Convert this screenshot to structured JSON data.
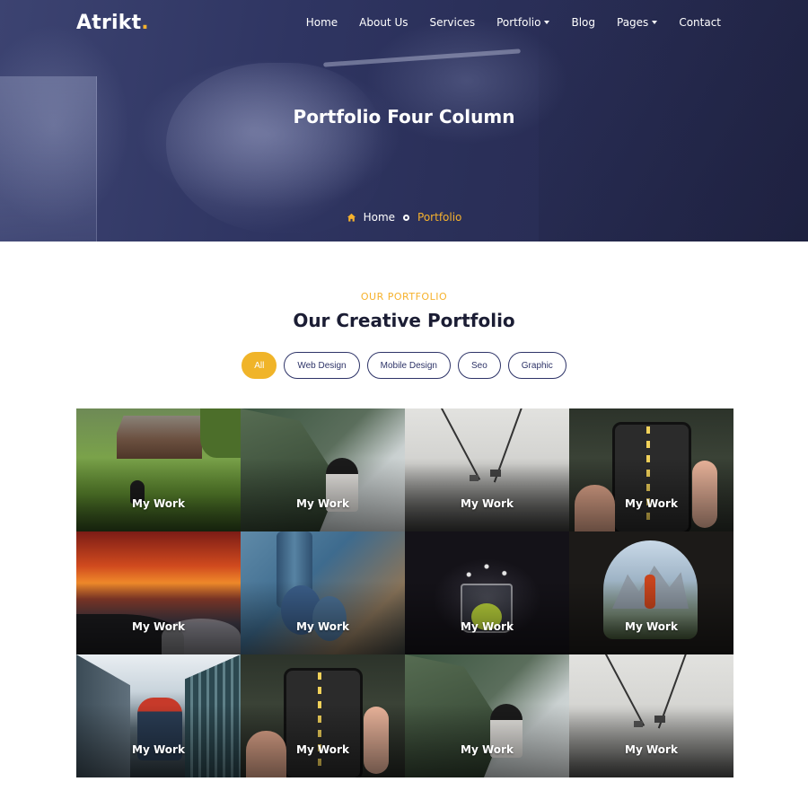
{
  "brand": {
    "name": "Atrikt",
    "dot": "."
  },
  "nav": {
    "items": [
      {
        "label": "Home",
        "dropdown": false
      },
      {
        "label": "About Us",
        "dropdown": false
      },
      {
        "label": "Services",
        "dropdown": false
      },
      {
        "label": "Portfolio",
        "dropdown": true
      },
      {
        "label": "Blog",
        "dropdown": false
      },
      {
        "label": "Pages",
        "dropdown": true
      },
      {
        "label": "Contact",
        "dropdown": false
      }
    ]
  },
  "hero": {
    "title": "Portfolio Four Column",
    "breadcrumb": {
      "home": "Home",
      "current": "Portfolio"
    }
  },
  "section": {
    "eyebrow": "OUR PORTFOLIO",
    "title": "Our Creative Portfolio"
  },
  "filters": [
    {
      "label": "All",
      "active": true
    },
    {
      "label": "Web Design",
      "active": false
    },
    {
      "label": "Mobile Design",
      "active": false
    },
    {
      "label": "Seo",
      "active": false
    },
    {
      "label": "Graphic",
      "active": false
    }
  ],
  "portfolio": [
    {
      "caption": "My Work",
      "image": "cabin-meadow"
    },
    {
      "caption": "My Work",
      "image": "person-mountain"
    },
    {
      "caption": "My Work",
      "image": "cable-car-fog"
    },
    {
      "caption": "My Work",
      "image": "phone-road"
    },
    {
      "caption": "My Work",
      "image": "sunset-sea"
    },
    {
      "caption": "My Work",
      "image": "pigeons"
    },
    {
      "caption": "My Work",
      "image": "lime-splash"
    },
    {
      "caption": "My Work",
      "image": "cave-mountains"
    },
    {
      "caption": "My Work",
      "image": "city-skater"
    },
    {
      "caption": "My Work",
      "image": "phone-road"
    },
    {
      "caption": "My Work",
      "image": "person-mountain"
    },
    {
      "caption": "My Work",
      "image": "cable-car-fog"
    }
  ],
  "colors": {
    "accent": "#f6b22d",
    "navy": "#2e3468",
    "hero_overlay": "#2f3562",
    "heading": "#1b1d34"
  }
}
